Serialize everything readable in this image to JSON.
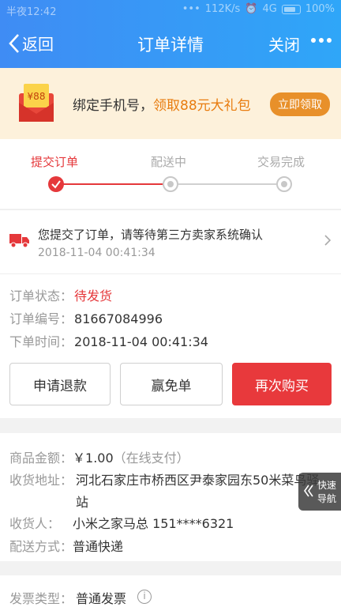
{
  "statusbar": {
    "time": "半夜12:42",
    "speed": "112K/s",
    "network": "4G",
    "battery": "100%"
  },
  "nav": {
    "back_label": "返回",
    "title": "订单详情",
    "close_label": "关闭"
  },
  "banner": {
    "envelope_amount": "¥88",
    "text_prefix": "绑定手机号，",
    "text_highlight": "领取88元大礼包",
    "button_label": "立即领取"
  },
  "steps": [
    {
      "label": "提交订单",
      "state": "done"
    },
    {
      "label": "配送中",
      "state": "pending"
    },
    {
      "label": "交易完成",
      "state": "pending"
    }
  ],
  "notice": {
    "text": "您提交了订单，请等待第三方卖家系统确认",
    "time": "2018-11-04 00:41:34"
  },
  "order": {
    "status_label": "订单状态：",
    "status_value": "待发货",
    "number_label": "订单编号：",
    "number_value": "81667084996",
    "time_label": "下单时间：",
    "time_value": "2018-11-04 00:41:34"
  },
  "actions": {
    "refund": "申请退款",
    "free": "赢免单",
    "rebuy": "再次购买"
  },
  "goods": {
    "amount_label": "商品金额：",
    "amount_value": "￥1.00",
    "amount_note": "（在线支付）",
    "address_label": "收货地址：",
    "address_value": "河北石家庄市桥西区尹泰家园东50米菜鸟驿站",
    "receiver_label": "收货人：",
    "receiver_value": "小米之家马总 151****6321",
    "shipping_label": "配送方式：",
    "shipping_value": "普通快递"
  },
  "invoice": {
    "label": "发票类型：",
    "value": "普通发票"
  },
  "quicknav": {
    "line1": "快速",
    "line2": "导航"
  },
  "colors": {
    "header": "#3f8cf4",
    "accent_red": "#e5383b",
    "banner_bg": "#fdf1db",
    "banner_orange": "#e8902a"
  }
}
